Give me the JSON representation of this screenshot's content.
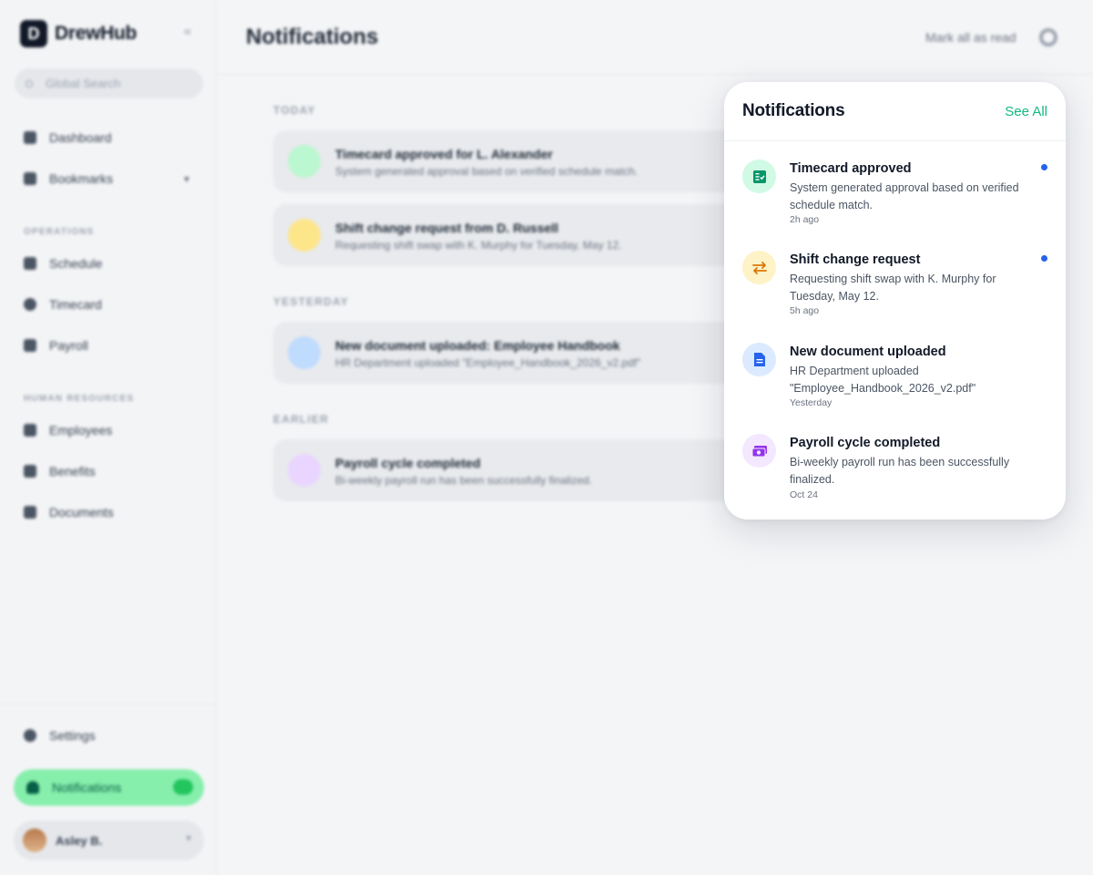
{
  "app": {
    "brand_letter": "D",
    "brand_name": "DrewHub",
    "search_placeholder": "Global Search",
    "nav": {
      "dashboard": "Dashboard",
      "bookmarks": "Bookmarks",
      "operations_label": "OPERATIONS",
      "schedule": "Schedule",
      "timecard": "Timecard",
      "payroll": "Payroll",
      "hr_label": "HUMAN RESOURCES",
      "employees": "Employees",
      "benefits": "Benefits",
      "documents": "Documents",
      "settings": "Settings",
      "notifications": "Notifications"
    },
    "user_name": "Asley B."
  },
  "main": {
    "title": "Notifications",
    "mark_all_read": "Mark all as read",
    "groups": {
      "today": "TODAY",
      "yesterday": "YESTERDAY",
      "earlier": "EARLIER"
    },
    "cards": [
      {
        "title": "Timecard approved for L. Alexander",
        "desc": "System generated approval based on verified schedule match."
      },
      {
        "title": "Shift change request from D. Russell",
        "desc": "Requesting shift swap with K. Murphy for Tuesday, May 12."
      },
      {
        "title": "New document uploaded: Employee Handbook",
        "desc": "HR Department uploaded \"Employee_Handbook_2026_v2.pdf\""
      },
      {
        "title": "Payroll cycle completed",
        "desc": "Bi-weekly payroll run has been successfully finalized."
      }
    ]
  },
  "popup": {
    "title": "Notifications",
    "see_all": "See All",
    "items": [
      {
        "title": "Timecard approved",
        "desc": "System generated approval based on verified schedule match.",
        "time": "2h ago",
        "icon": "timecard-check-icon",
        "unread": true
      },
      {
        "title": "Shift change request",
        "desc": "Requesting shift swap with K. Murphy for Tuesday, May 12.",
        "time": "5h ago",
        "icon": "swap-arrows-icon",
        "unread": true
      },
      {
        "title": "New document uploaded",
        "desc": "HR Department uploaded \"Employee_Handbook_2026_v2.pdf\"",
        "time": "Yesterday",
        "icon": "document-icon",
        "unread": false
      },
      {
        "title": "Payroll cycle completed",
        "desc": "Bi-weekly payroll run has been successfully finalized.",
        "time": "Oct 24",
        "icon": "payroll-money-icon",
        "unread": false
      }
    ]
  },
  "colors": {
    "accent": "#10b981",
    "unread_dot": "#2563eb",
    "green_icon_bg": "#d1fae5",
    "yellow_icon_bg": "#fef3c7",
    "blue_icon_bg": "#dbeafe",
    "purple_icon_bg": "#f3e8ff"
  }
}
